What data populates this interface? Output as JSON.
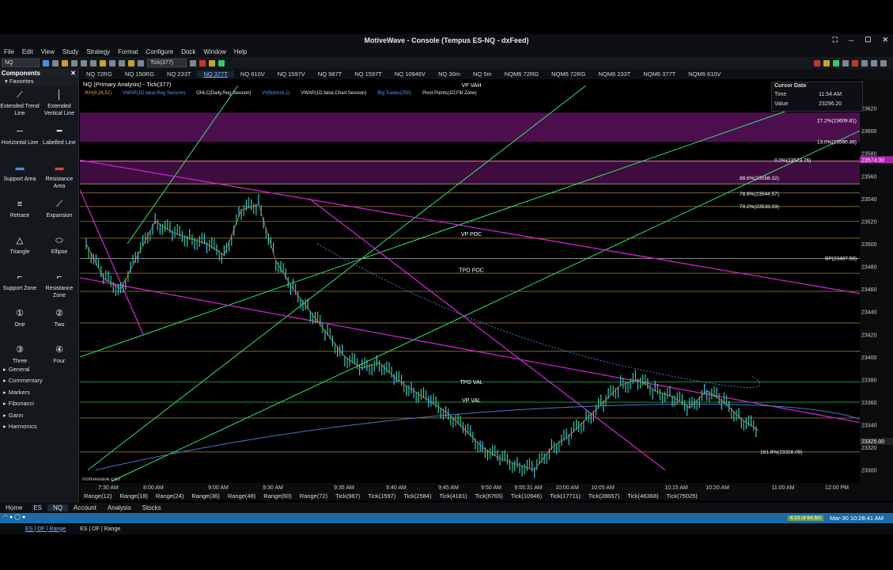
{
  "window": {
    "title": "MotiveWave - Console (Tempus ES-NQ - dxFeed)"
  },
  "menu": [
    "File",
    "Edit",
    "View",
    "Study",
    "Strategy",
    "Format",
    "Configure",
    "Dock",
    "Window",
    "Help"
  ],
  "toolbar": {
    "symbol": "NQ",
    "bar_type": "Tick(377)"
  },
  "sidebar": {
    "title": "Components",
    "favorites": "Favorites",
    "tools": [
      {
        "label": "Extended Trend Line",
        "icon": "trend-line-icon",
        "glyph": "⟋"
      },
      {
        "label": "Extended Vertical Line",
        "icon": "vertical-line-icon",
        "glyph": "│"
      },
      {
        "label": "Horizontal Line",
        "icon": "horizontal-line-icon",
        "glyph": "─"
      },
      {
        "label": "Labelled Line",
        "icon": "labelled-line-icon",
        "glyph": "━"
      },
      {
        "label": "Support Area",
        "icon": "support-area-icon",
        "glyph": "▬"
      },
      {
        "label": "Resistance Area",
        "icon": "resistance-area-icon",
        "glyph": "▬"
      },
      {
        "label": "Retrace",
        "icon": "retrace-icon",
        "glyph": "≡"
      },
      {
        "label": "Expansion",
        "icon": "expansion-icon",
        "glyph": "⟋"
      },
      {
        "label": "Triangle",
        "icon": "triangle-icon",
        "glyph": "△"
      },
      {
        "label": "Ellipse",
        "icon": "ellipse-icon",
        "glyph": "⬭"
      },
      {
        "label": "Support Zone",
        "icon": "support-zone-icon",
        "glyph": "⌐"
      },
      {
        "label": "Resistance Zone",
        "icon": "resistance-zone-icon",
        "glyph": "⌐"
      },
      {
        "label": "One",
        "icon": "one-icon",
        "glyph": "①"
      },
      {
        "label": "Two",
        "icon": "two-icon",
        "glyph": "②"
      },
      {
        "label": "Three",
        "icon": "three-icon",
        "glyph": "③"
      },
      {
        "label": "Four",
        "icon": "four-icon",
        "glyph": "④"
      }
    ],
    "categories": [
      "General",
      "Commentary",
      "Markers",
      "Fibonacci",
      "Gann",
      "Harmonics"
    ]
  },
  "chart_tabs": [
    "NQ 72RG",
    "NQ 150RG",
    "NQ 233T",
    "NQ 377T",
    "NQ 610V",
    "NQ 1597V",
    "NQ 987T",
    "NQ 1597T",
    "NQ 10946V",
    "NQ 30m",
    "NQ 5m",
    "NQM6 72RG",
    "NQM6 72RG",
    "NQM6 233T",
    "NQM6 377T",
    "NQM6 610V"
  ],
  "active_tab": 3,
  "chart_header": {
    "title": "NQ (Primary Analysis) - Tick(377)",
    "studies": [
      "IKH(9,26,52)",
      "VWAP(1D,false,Reg Session)",
      "OHLC(Daily,Reg Session)",
      "VI(Bid/Ask,1)",
      "VWAP(1D,false,Chart Session)",
      "Big Trades(250)",
      "Pivot Points(1D,Fib Zone)"
    ]
  },
  "cursor_data": {
    "title": "Cursor Data",
    "time_label": "Time",
    "time": "11:54 AM",
    "value_label": "Value",
    "value": "23296.20"
  },
  "level_labels": {
    "vp_vah": "VP VAH",
    "vp_poc": "VP POC",
    "tpo_poc": "TPO POC",
    "tpo_val": "TPO VAL",
    "vp_val": "VP VAL"
  },
  "fib_labels": [
    "27.2%(23609.81)",
    "13.0%(23590.46)",
    "0.0%(23573.76)",
    "88.6%(23558.32)",
    "78.6%(23544.57)",
    "70.2%(23533.03)",
    "161.8%(23316.09)",
    "BP(23487.58)"
  ],
  "price_tags": {
    "high": "23574.00",
    "last": "23325.00"
  },
  "watermark": "motivewave.com",
  "ranges": [
    "Range(12)",
    "Range(18)",
    "Range(24)",
    "Range(36)",
    "Range(48)",
    "Range(60)",
    "Range(72)",
    "Tick(987)",
    "Tick(1597)",
    "Tick(2584)",
    "Tick(4181)",
    "Tick(6765)",
    "Tick(10946)",
    "Tick(17711)",
    "Tick(28657)",
    "Tick(46368)",
    "Tick(75025)"
  ],
  "bottom_tabs": [
    "Home",
    "ES",
    "NQ",
    "Account",
    "Analysis",
    "Stocks"
  ],
  "status": {
    "badge": "4.10 of 64.5G",
    "datetime": "Mar-30 10:28:41 AM"
  },
  "linkbar": [
    "ES | OF | Range",
    "ES | OF | Range"
  ],
  "colors": {
    "accent": "#1e6aa8",
    "magenta": "#cc22cc",
    "green": "#2ee86a",
    "orange": "#d88a1a"
  },
  "chart_data": {
    "type": "line",
    "price_axis": {
      "ylim": [
        23290,
        23640
      ],
      "ticks": [
        23300,
        23320,
        23340,
        23360,
        23380,
        23400,
        23420,
        23440,
        23460,
        23480,
        23500,
        23520,
        23540,
        23560,
        23580,
        23600,
        23620
      ]
    },
    "time_axis": [
      "7:30 AM",
      "8:00 AM",
      "9:00 AM",
      "9:30 AM",
      "9:35 AM",
      "9:40 AM",
      "9:45 AM",
      "9:50 AM",
      "9:55:31 AM",
      "10:00 AM",
      "10:05 AM",
      "10:15 AM",
      "10:20 AM",
      "11:00 AM",
      "12:00 PM"
    ],
    "series": [
      {
        "name": "price",
        "values": [
          23500,
          23470,
          23460,
          23490,
          23520,
          23510,
          23505,
          23500,
          23490,
          23530,
          23535,
          23485,
          23460,
          23440,
          23420,
          23400,
          23390,
          23395,
          23380,
          23370,
          23360,
          23350,
          23335,
          23320,
          23310,
          23305,
          23300,
          23320,
          23330,
          23345,
          23360,
          23375,
          23380,
          23370,
          23365,
          23355,
          23370,
          23360,
          23345,
          23335
        ]
      }
    ]
  }
}
